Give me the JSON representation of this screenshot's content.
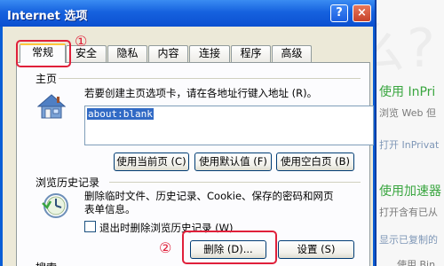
{
  "background_page": {
    "line1": "使用 InPri",
    "line2": "浏览 Web 但",
    "line3": "打开 InPrivat",
    "line4": "使用加速器",
    "line5": "打开含有已从",
    "line6": "显示已复制的",
    "line7": "使用 Bin"
  },
  "dialog": {
    "title": "Internet 选项",
    "help_label": "?",
    "close_label": "×",
    "tabs": [
      {
        "label": "常规",
        "active": true
      },
      {
        "label": "安全",
        "active": false
      },
      {
        "label": "隐私",
        "active": false
      },
      {
        "label": "内容",
        "active": false
      },
      {
        "label": "连接",
        "active": false
      },
      {
        "label": "程序",
        "active": false
      },
      {
        "label": "高级",
        "active": false
      }
    ],
    "homepage": {
      "section_label": "主页",
      "instruction": "若要创建主页选项卡，请在各地址行键入地址 (R)。",
      "address_value": "about:blank",
      "buttons": {
        "use_current": "使用当前页 (C)",
        "use_default": "使用默认值 (F)",
        "use_blank": "使用空白页 (B)"
      }
    },
    "history": {
      "section_label": "浏览历史记录",
      "description_line1": "删除临时文件、历史记录、Cookie、保存的密码和网页",
      "description_line2": "表单信息。",
      "delete_on_exit_label": "退出时删除浏览历史记录 (W)",
      "delete_on_exit_checked": false,
      "buttons": {
        "delete": "删除 (D)...",
        "settings": "设置 (S)"
      }
    },
    "search_section_label": "搜索"
  },
  "annotations": {
    "callout_1": "①",
    "callout_2": "②",
    "color": "#e0203a"
  },
  "colors": {
    "titlebar": "#1662df",
    "dialog_face": "#ece9d8",
    "selection": "#316ac5"
  }
}
